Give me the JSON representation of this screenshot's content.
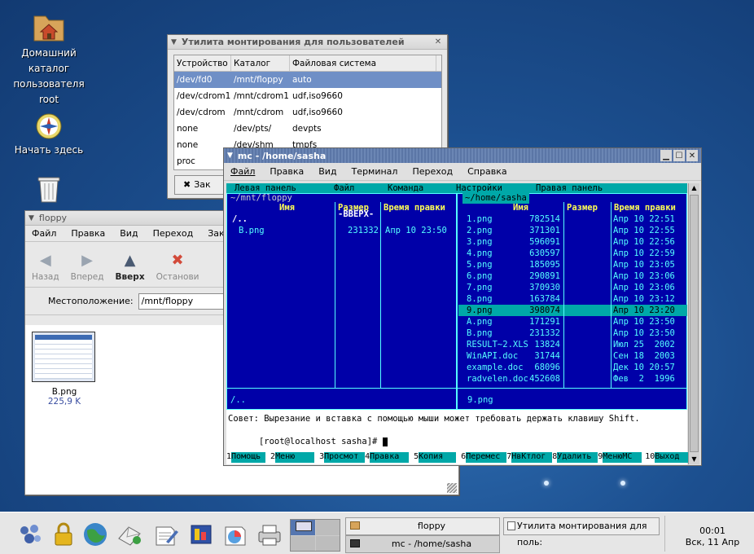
{
  "desktop": {
    "home_icon_label": "Домашний каталог пользователя root",
    "start_icon_label": "Начать здесь",
    "trash_icon_label": ""
  },
  "mount_window": {
    "title": "Утилита монтирования для пользователей",
    "headers": [
      "Устройство",
      "Каталог",
      "Файловая система"
    ],
    "rows": [
      [
        "/dev/fd0",
        "/mnt/floppy",
        "auto"
      ],
      [
        "/dev/cdrom1",
        "/mnt/cdrom1",
        "udf,iso9660"
      ],
      [
        "/dev/cdrom",
        "/mnt/cdrom",
        "udf,iso9660"
      ],
      [
        "none",
        "/dev/pts/",
        "devpts"
      ],
      [
        "none",
        "/dev/shm",
        "tmpfs"
      ],
      [
        "proc",
        "",
        ""
      ]
    ],
    "close_button_label": "Зак"
  },
  "floppy_window": {
    "title": "floppy",
    "menu": [
      "Файл",
      "Правка",
      "Вид",
      "Переход",
      "Закл"
    ],
    "toolbar": {
      "back": "Назад",
      "forward": "Вперед",
      "up": "Вверх",
      "stop": "Останови"
    },
    "location_label": "Местоположение:",
    "location_value": "/mnt/floppy",
    "file": {
      "name": "B.png",
      "size": "225,9 K"
    }
  },
  "mc_window": {
    "title": "mc - /home/sasha",
    "menu": [
      "Файл",
      "Правка",
      "Вид",
      "Терминал",
      "Переход",
      "Справка"
    ],
    "topbar": [
      "Левая панель",
      "Файл",
      "Команда",
      "Настройки",
      "Правая панель"
    ],
    "left_panel": {
      "path": "~/mnt/floppy",
      "col_name": "Имя",
      "col_size": "Размер",
      "col_time": "Время правки",
      "updir_name": "/..",
      "updir_size": "-ВВЕРХ-",
      "files": [
        {
          "name": "B.png",
          "size": "231332",
          "time": "Апр 10 23:50"
        }
      ],
      "status": "/.."
    },
    "right_panel": {
      "path": "~/home/sasha",
      "col_name": "Имя",
      "col_size": "Размер",
      "col_time": "Время правки",
      "files": [
        {
          "name": "1.png",
          "size": "782514",
          "time": "Апр 10 22:51"
        },
        {
          "name": "2.png",
          "size": "371301",
          "time": "Апр 10 22:55"
        },
        {
          "name": "3.png",
          "size": "596091",
          "time": "Апр 10 22:56"
        },
        {
          "name": "4.png",
          "size": "630597",
          "time": "Апр 10 22:59"
        },
        {
          "name": "5.png",
          "size": "185095",
          "time": "Апр 10 23:05"
        },
        {
          "name": "6.png",
          "size": "290891",
          "time": "Апр 10 23:06"
        },
        {
          "name": "7.png",
          "size": "370930",
          "time": "Апр 10 23:06"
        },
        {
          "name": "8.png",
          "size": "163784",
          "time": "Апр 10 23:12"
        },
        {
          "name": "9.png",
          "size": "398074",
          "time": "Апр 10 23:20"
        },
        {
          "name": "A.png",
          "size": "171291",
          "time": "Апр 10 23:50"
        },
        {
          "name": "B.png",
          "size": "231332",
          "time": "Апр 10 23:50"
        },
        {
          "name": "RESULT~2.XLS",
          "size": "13824",
          "time": "Июл 25  2002"
        },
        {
          "name": "WinAPI.doc",
          "size": "31744",
          "time": "Сен 18  2003"
        },
        {
          "name": "example.doc",
          "size": "68096",
          "time": "Дек 10 20:57"
        },
        {
          "name": "radvelen.doc",
          "size": "452608",
          "time": "Фев  2  1996"
        }
      ],
      "status": "9.png"
    },
    "hint": "Совет: Вырезание и вставка с помощью мыши может требовать держать клавишу Shift.",
    "prompt": "[root@localhost sasha]# ",
    "fkeys": [
      {
        "n": "1",
        "label": "Помощь"
      },
      {
        "n": "2",
        "label": "Меню"
      },
      {
        "n": "3",
        "label": "Просмот"
      },
      {
        "n": "4",
        "label": "Правка"
      },
      {
        "n": "5",
        "label": "Копия"
      },
      {
        "n": "6",
        "label": "Перемес"
      },
      {
        "n": "7",
        "label": "НвКтлог"
      },
      {
        "n": "8",
        "label": "Удалить"
      },
      {
        "n": "9",
        "label": "МенюМС"
      },
      {
        "n": "10",
        "label": "Выход"
      }
    ]
  },
  "taskbar": {
    "tasks": [
      "floppy",
      "mc - /home/sasha",
      "Утилита монтирования для поль:"
    ],
    "clock_time": "00:01",
    "clock_date": "Вск, 11 Апр"
  }
}
